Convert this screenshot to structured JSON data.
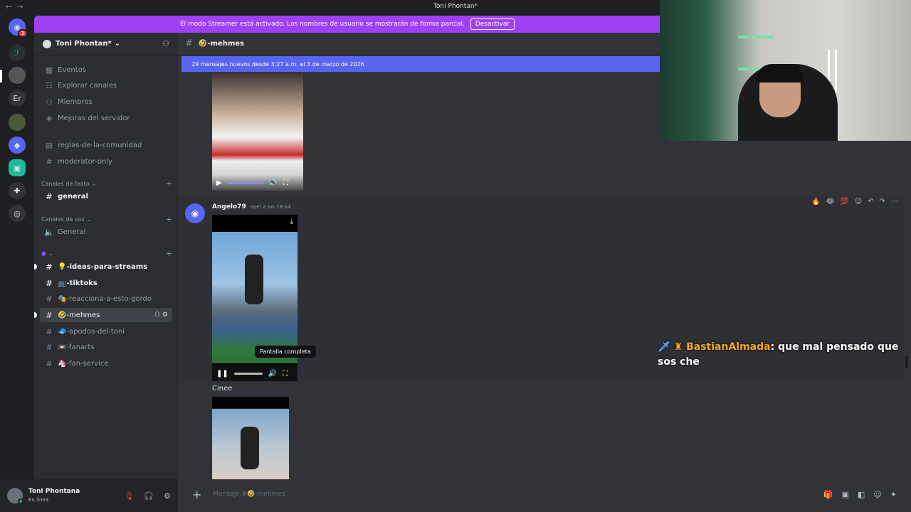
{
  "window": {
    "title": "Toni Phontan*"
  },
  "banner": {
    "text": "El modo Streamer está activado. Los nombres de usuario se mostrarán de forma parcial.",
    "button": "Desactivar"
  },
  "servers": {
    "badge": "3",
    "text_server": "Er"
  },
  "guild": {
    "name": "Toni Phontan*"
  },
  "sidebar": {
    "top_items": [
      {
        "label": "Eventos",
        "icon": "calendar-icon"
      },
      {
        "label": "Explorar canales",
        "icon": "browse-icon"
      },
      {
        "label": "Miembros",
        "icon": "members-icon"
      },
      {
        "label": "Mejoras del servidor",
        "icon": "boost-icon"
      }
    ],
    "pinned": [
      {
        "label": "reglas-de-la-comunidad"
      },
      {
        "label": "moderator-only"
      }
    ],
    "cat_text": "Canales de texto",
    "general_text": "general",
    "cat_voice": "Canales de voz",
    "general_voice": "General",
    "custom": [
      {
        "label": "💡-ideas-para-streams"
      },
      {
        "label": "📺-tiktoks"
      },
      {
        "label": "🎭-reacciona-a-esto-gordo"
      },
      {
        "label": "🤣-mehmes"
      },
      {
        "label": "🧢-apodos-del-toni"
      },
      {
        "label": "📼-fanarts"
      },
      {
        "label": "🦄-fan-service"
      }
    ]
  },
  "user": {
    "name": "Toni Phontana",
    "status": "En línea"
  },
  "channel": {
    "name": "🤣-mehmes",
    "new_messages": "29 mensajes nuevos desde 3:27 a.m. el 3 de marzo de 2026"
  },
  "message": {
    "author": "Angelo79",
    "time": "ayer a las 18:04",
    "caption": "Cinee",
    "tooltip": "Pantalla completa"
  },
  "composer": {
    "placeholder": "Mensaje #🤣-mehmes"
  },
  "overlay": {
    "user": "BastianAlmada",
    "text": "que mal pensado que sos che"
  }
}
